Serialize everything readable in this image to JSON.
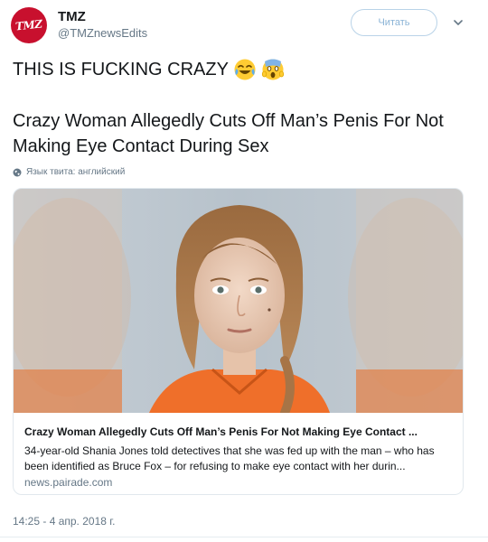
{
  "user": {
    "avatar_text": "TMZ",
    "name": "TMZ",
    "handle": "@TMZnewsEdits"
  },
  "follow_label": "Читать",
  "tweet": {
    "text": "THIS IS FUCKING CRAZY",
    "emojis": [
      "face-with-tears-of-joy",
      "face-screaming-in-fear"
    ]
  },
  "headline": "Crazy Woman Allegedly Cuts Off Man’s Penis For Not Making Eye Contact During Sex",
  "language_note": "Язык твита: английский",
  "card": {
    "title": "Crazy Woman Allegedly Cuts Off Man’s Penis For Not Making Eye Contact ...",
    "description": "34-year-old Shania Jones told detectives that she was fed up with the man – who has been identified as Bruce Fox – for refusing to make eye contact with her durin...",
    "domain": "news.pairade.com"
  },
  "timestamp": "14:25 - 4 апр. 2018 г.",
  "colors": {
    "brand_red": "#c8102e",
    "text_primary": "#14171a",
    "text_secondary": "#657786",
    "follow_border": "#b9d3e8"
  }
}
